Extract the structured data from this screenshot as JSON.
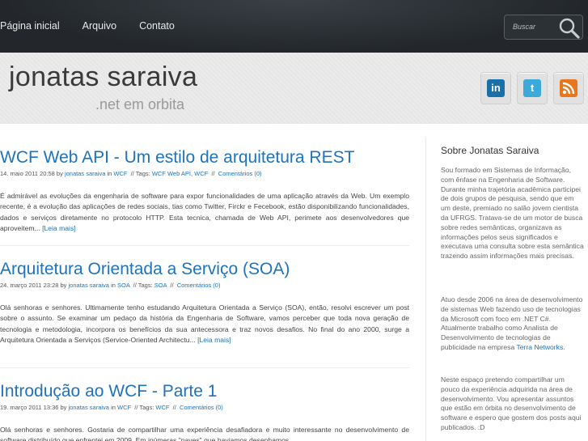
{
  "nav": {
    "items": [
      "Página inicial",
      "Arquivo",
      "Contato"
    ],
    "search_placeholder": "Buscar"
  },
  "header": {
    "title": "jonatas saraiva",
    "subtitle": ".net em orbita",
    "social": [
      {
        "icon": "linkedin-icon",
        "glyph": "in",
        "color": "#1b6fa8"
      },
      {
        "icon": "twitter-icon",
        "glyph": "t",
        "color": "#3ba9d9"
      },
      {
        "icon": "rss-icon",
        "glyph": "",
        "color": "#e8761c"
      }
    ]
  },
  "posts": [
    {
      "title": "WCF Web API - Um estilo de arquitetura REST",
      "date": "14. maio 2011 20:58 by",
      "author": "jonatas saraiva",
      "in": "in",
      "category": "WCF",
      "tags_label": "// Tags:",
      "tags": "WCF Web API, WCF",
      "sep": "//",
      "comments": "Comentários (0)",
      "excerpt": "É admirável as evoluções da engenharia de software para expor funcionalidades de uma aplicação através da Web. Um exemplo recente, é a evolução das aplicações de redes sociais, tias como Twitter, Firckr e Fecebook, estão disponibilizando funcionalidades, dados e serviços diretamente no protocolo HTTP. Esta tecnica, chamada de Web API, perimete aos desenvolvedores que aproveitem...",
      "more": "[Leia mais]"
    },
    {
      "title": "Arquitetura Orientada a Serviço (SOA)",
      "date": "24. março 2011 23:28 by",
      "author": "jonatas saraiva",
      "in": "in",
      "category": "SOA",
      "tags_label": "// Tags:",
      "tags": "SOA",
      "sep": "//",
      "comments": "Comentários (0)",
      "excerpt": "Olá senhoras e senhores. Ultimamente tenho estudando Arquitetura Orientada a Serviço (SOA), então, resolvi escrever um post sobre o assunto. Se examinar um pedaço da história da Engenharia de Software, vamos perceber que toda nova geração de tecnologia e metodologia, incorpora os benefícios da sua antecessora e traz novos desafios. No final do ano 2000, surge a Arquitetura Orientada a Serviços (Service-Oriented Architectu...",
      "more": "[Leia mais]"
    },
    {
      "title": "Introdução ao WCF - Parte 1",
      "date": "19. março 2011 13:36 by",
      "author": "jonatas saraiva",
      "in": "in",
      "category": "WCF",
      "tags_label": "// Tags:",
      "tags": "WCF",
      "sep": "//",
      "comments": "Comentários (0)",
      "excerpt": "Olá senhoras e senhores. Gostaria de compartilhar uma experiência desafiadora e muito interessante no desenvolvimento de software distribuído que enfrentei em 2009. Em inúmeras \"naves\" que haviamos desenhamos",
      "more": ""
    }
  ],
  "sidebar": {
    "title": "Sobre Jonatas Saraiva",
    "p1": "Sou formado em Sistemas de Informação, com ênfase na Engenharia de Software. Durante minha trajetória acadêmica participei de dois grupos de pesquisa, sendo que em um deste, premiado no salão jovem cientista da UFRGS. Tratava-se de um motor de busca sobre redes semânticas, organizava as informações pelos seus significados e executava uma consulta sobre esta semântica trazendo assim informações mais precisas.",
    "p2_text": "Atuo desde 2006 na área de desenvolvimento de sistemas Web fazendo uso de tecnologias da Microsoft com foco em .NET C#. Atualmente trabalho como Analista de Desenvolvimento de tecnologias de publicidade na empresa",
    "p2_link": "Terra Networks",
    "p2_end": ".",
    "p3": "Neste espaço pretendo compartilhar um pouco da experiência adquirida na área de desenvolvimento. Vou apresentar assuntos que estão em órbita no desenvolvimento de software e espero que gostem dos posts aqui publicados. :D"
  }
}
